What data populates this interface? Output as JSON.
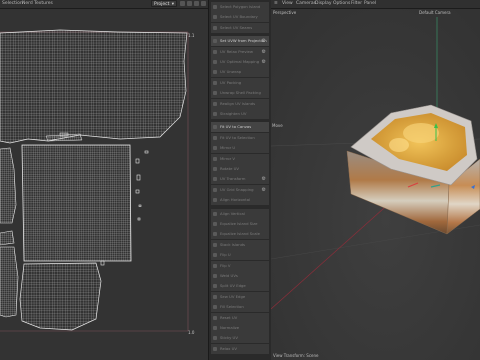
{
  "uv_menu": {
    "items": [
      "Selection",
      "Nerd",
      "Textures"
    ],
    "dropdown": "Project"
  },
  "uv_axes": {
    "top_right": "1.1",
    "bottom_right": "1.0"
  },
  "tools": {
    "items": [
      {
        "label": "Select Polygon Island",
        "hi": false,
        "gear": false
      },
      {
        "label": "Select UV Boundary",
        "hi": false,
        "gear": false
      },
      {
        "label": "Select UV Seams",
        "hi": false,
        "gear": false
      },
      {
        "label": "Set UVW from Projection",
        "hi": true,
        "gear": true
      },
      {
        "label": "UV Relax Preview",
        "hi": false,
        "gear": true
      },
      {
        "label": "UV Optimal Mapping",
        "hi": false,
        "gear": true
      },
      {
        "label": "UV Unwrap",
        "hi": false,
        "gear": false
      },
      {
        "label": "UV Packing",
        "hi": false,
        "gear": false
      },
      {
        "label": "Unwrap Shell Packing",
        "hi": false,
        "gear": false
      },
      {
        "label": "Realign UV Islands",
        "hi": false,
        "gear": false
      },
      {
        "label": "Straighten UV",
        "hi": false,
        "gear": false
      },
      {
        "label": "Fit UV to Canvas",
        "hi": true,
        "gear": false
      },
      {
        "label": "Fit UV to Selection",
        "hi": false,
        "gear": false
      },
      {
        "label": "Mirror U",
        "hi": false,
        "gear": false
      },
      {
        "label": "Mirror V",
        "hi": false,
        "gear": false
      },
      {
        "label": "Rotate UV",
        "hi": false,
        "gear": false
      },
      {
        "label": "UV Transform",
        "hi": false,
        "gear": true
      },
      {
        "label": "UV Grid Snapping",
        "hi": false,
        "gear": true
      },
      {
        "label": "Align Horizontal",
        "hi": false,
        "gear": false
      },
      {
        "label": "Align Vertical",
        "hi": false,
        "gear": false
      },
      {
        "label": "Equalize Island Size",
        "hi": false,
        "gear": false
      },
      {
        "label": "Equalize Island Scale",
        "hi": false,
        "gear": false
      },
      {
        "label": "Stack Islands",
        "hi": false,
        "gear": false
      },
      {
        "label": "Flip U",
        "hi": false,
        "gear": false
      },
      {
        "label": "Flip V",
        "hi": false,
        "gear": false
      },
      {
        "label": "Weld UVs",
        "hi": false,
        "gear": false
      },
      {
        "label": "Split UV Edge",
        "hi": false,
        "gear": false
      },
      {
        "label": "Sew UV Edge",
        "hi": false,
        "gear": false
      },
      {
        "label": "Fill Selection",
        "hi": false,
        "gear": false
      },
      {
        "label": "Reset UV",
        "hi": false,
        "gear": false
      },
      {
        "label": "Normalize",
        "hi": false,
        "gear": false
      },
      {
        "label": "Sticky UV",
        "hi": false,
        "gear": false
      },
      {
        "label": "Relax UV",
        "hi": false,
        "gear": false
      }
    ]
  },
  "viewport_menu": {
    "items": [
      "View",
      "Cameras",
      "Display",
      "Options",
      "Filter",
      "Panel"
    ]
  },
  "viewport": {
    "perspective_label": "Perspective",
    "camera_label": "Default Camera",
    "move_label": "Move",
    "footer_label": "View Transform: Scene"
  },
  "colors": {
    "accent": "#4a8fd8",
    "uv_line": "#dcdcdc",
    "bg": "#333333",
    "axis_red": "#c0394a"
  }
}
